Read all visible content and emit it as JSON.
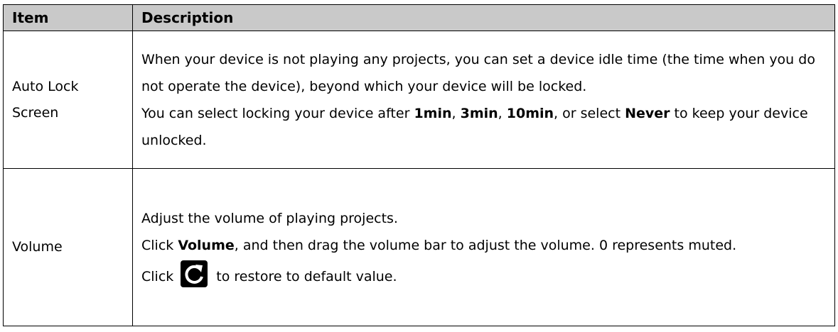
{
  "table": {
    "headers": {
      "item": "Item",
      "description": "Description"
    },
    "auto_lock": {
      "item_line1": "Auto Lock",
      "item_line2": "Screen",
      "desc_para1": "When your device is not playing any projects, you can set a device idle time (the time when you do not operate the device), beyond which your device will be locked.",
      "desc_para2_prefix": "You can select locking your device after ",
      "opt_1min": "1min",
      "sep1": ", ",
      "opt_3min": "3min",
      "sep2": ", ",
      "opt_10min": "10min",
      "sep3": ", or select ",
      "opt_never": "Never",
      "desc_para2_suffix": " to keep your device unlocked."
    },
    "volume": {
      "item": "Volume",
      "desc_para1": "Adjust the volume of playing projects.",
      "desc_para2_prefix": "Click ",
      "volume_bold": "Volume",
      "desc_para2_suffix": ", and then drag the volume bar to adjust the volume. 0 represents muted.",
      "click_prefix": "Click",
      "restore_suffix": "to restore to default value.",
      "restore_icon": "refresh-icon"
    }
  }
}
